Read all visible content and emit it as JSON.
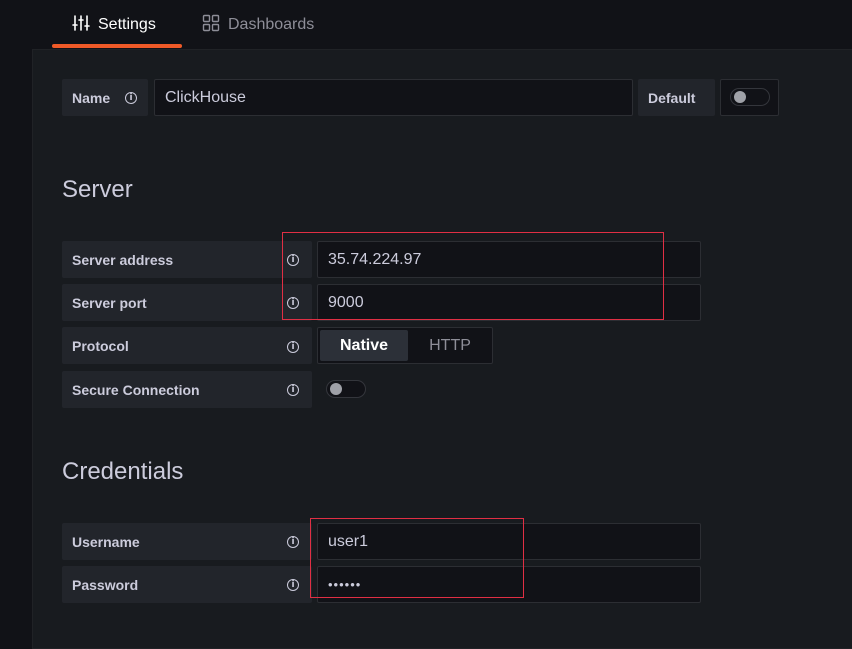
{
  "tabs": {
    "settings_label": "Settings",
    "dashboards_label": "Dashboards"
  },
  "name_row": {
    "label": "Name",
    "value": "ClickHouse",
    "default_label": "Default",
    "default_on": false
  },
  "server": {
    "title": "Server",
    "address_label": "Server address",
    "address_value": "35.74.224.97",
    "port_label": "Server port",
    "port_value": "9000",
    "protocol_label": "Protocol",
    "protocol_options": [
      "Native",
      "HTTP"
    ],
    "protocol_selected": "Native",
    "secure_label": "Secure Connection",
    "secure_on": false
  },
  "credentials": {
    "title": "Credentials",
    "username_label": "Username",
    "username_value": "user1",
    "password_label": "Password",
    "password_value": "••••••"
  },
  "colors": {
    "accent_tab": "#f05a28",
    "highlight_box": "#e02f44"
  }
}
